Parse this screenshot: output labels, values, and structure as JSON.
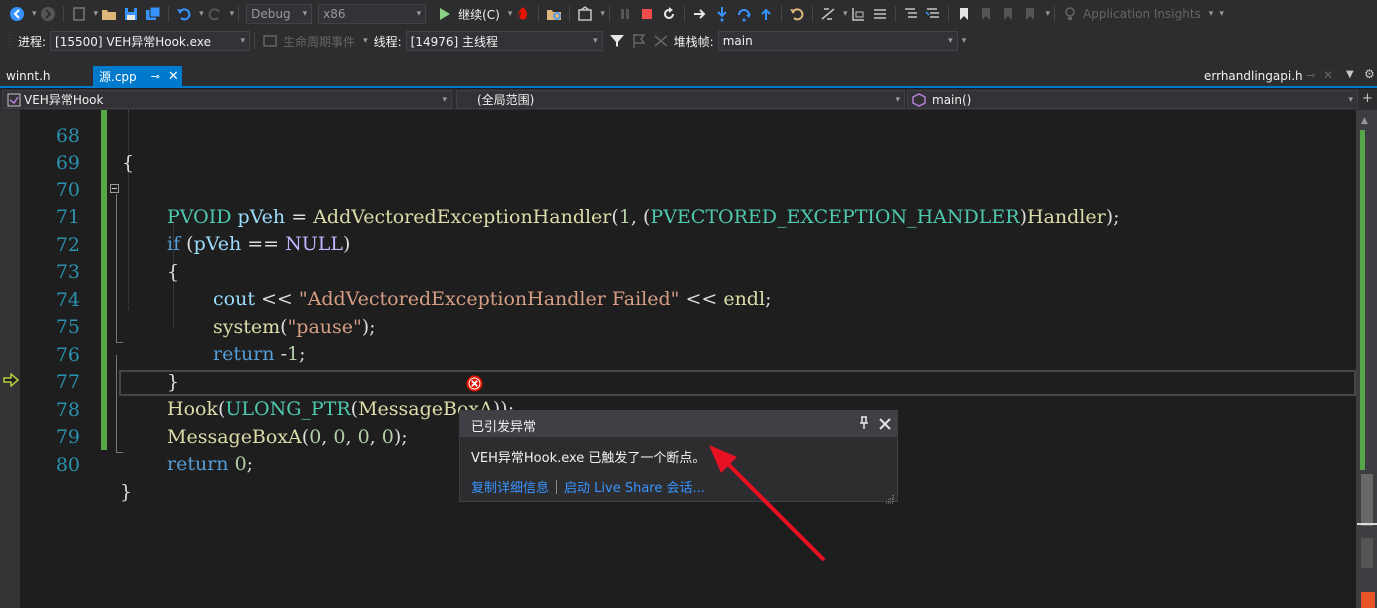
{
  "toolbar": {
    "config": "Debug",
    "platform": "x86",
    "continue_label": "继续(C)",
    "app_insights": "Application Insights"
  },
  "debugbar": {
    "process_label": "进程:",
    "process_value": "[15500] VEH异常Hook.exe",
    "lifecycle_label": "生命周期事件",
    "thread_label": "线程:",
    "thread_value": "[14976] 主线程",
    "stackframe_label": "堆栈帧:",
    "stackframe_value": "main"
  },
  "tabs": {
    "items": [
      {
        "label": "winnt.h"
      },
      {
        "label": "源.cpp"
      }
    ],
    "right_label": "errhandlingapi.h"
  },
  "navbar": {
    "project": "VEH异常Hook",
    "scope": "(全局范围)",
    "member": "main()"
  },
  "code": {
    "lines": [
      {
        "num": "68",
        "text": "{"
      },
      {
        "num": "69",
        "text": ""
      },
      {
        "num": "70",
        "text": "PVOID pVeh = AddVectoredExceptionHandler(1, (PVECTORED_EXCEPTION_HANDLER)Handler);"
      },
      {
        "num": "71",
        "text": "if (pVeh == NULL)"
      },
      {
        "num": "72",
        "text": "{"
      },
      {
        "num": "73",
        "text": "cout << \"AddVectoredExceptionHandler Failed\" << endl;"
      },
      {
        "num": "74",
        "text": "system(\"pause\");"
      },
      {
        "num": "75",
        "text": "return -1;"
      },
      {
        "num": "76",
        "text": "}"
      },
      {
        "num": "77",
        "text": "Hook(ULONG_PTR(MessageBoxA));"
      },
      {
        "num": "78",
        "text": "MessageBoxA(0, 0, 0, 0);"
      },
      {
        "num": "79",
        "text": "return 0;"
      },
      {
        "num": "80",
        "text": "}"
      }
    ]
  },
  "exception_popup": {
    "title": "已引发异常",
    "message": "VEH异常Hook.exe 已触发了一个断点。",
    "copy_details": "复制详细信息",
    "live_share": "启动 Live Share 会话..."
  },
  "colors": {
    "accent": "#007acc",
    "error": "#e51400",
    "annotation_arrow": "#e81123"
  }
}
